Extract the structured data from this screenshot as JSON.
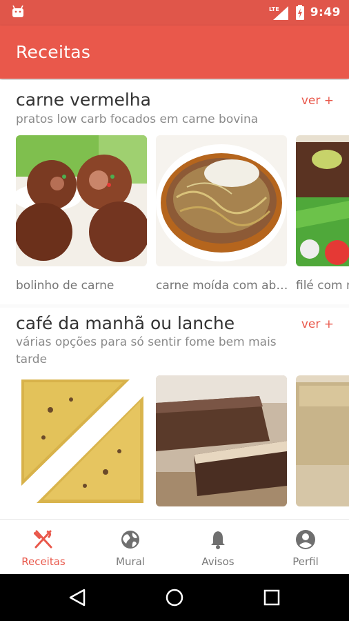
{
  "status_bar": {
    "network": "LTE",
    "time": "9:49"
  },
  "app_bar": {
    "title": "Receitas"
  },
  "sections": [
    {
      "title": "carne vermelha",
      "subtitle": "pratos low carb focados em carne bovina",
      "more": "ver +",
      "items": [
        {
          "label": "bolinho de carne"
        },
        {
          "label": "carne moída com abobrinha"
        },
        {
          "label": "filé com molho"
        }
      ]
    },
    {
      "title": "café da manhã ou lanche",
      "subtitle": "várias opções para só sentir fome bem mais tarde",
      "more": "ver +",
      "items": [
        {
          "label": ""
        },
        {
          "label": ""
        },
        {
          "label": ""
        }
      ]
    }
  ],
  "bottom_nav": [
    {
      "label": "Receitas",
      "icon": "fork-knife-icon",
      "active": true
    },
    {
      "label": "Mural",
      "icon": "globe-icon",
      "active": false
    },
    {
      "label": "Avisos",
      "icon": "bell-icon",
      "active": false
    },
    {
      "label": "Perfil",
      "icon": "account-icon",
      "active": false
    }
  ],
  "colors": {
    "primary": "#e9584b",
    "status_bar": "#e0564a",
    "inactive": "#7a7a7a"
  }
}
